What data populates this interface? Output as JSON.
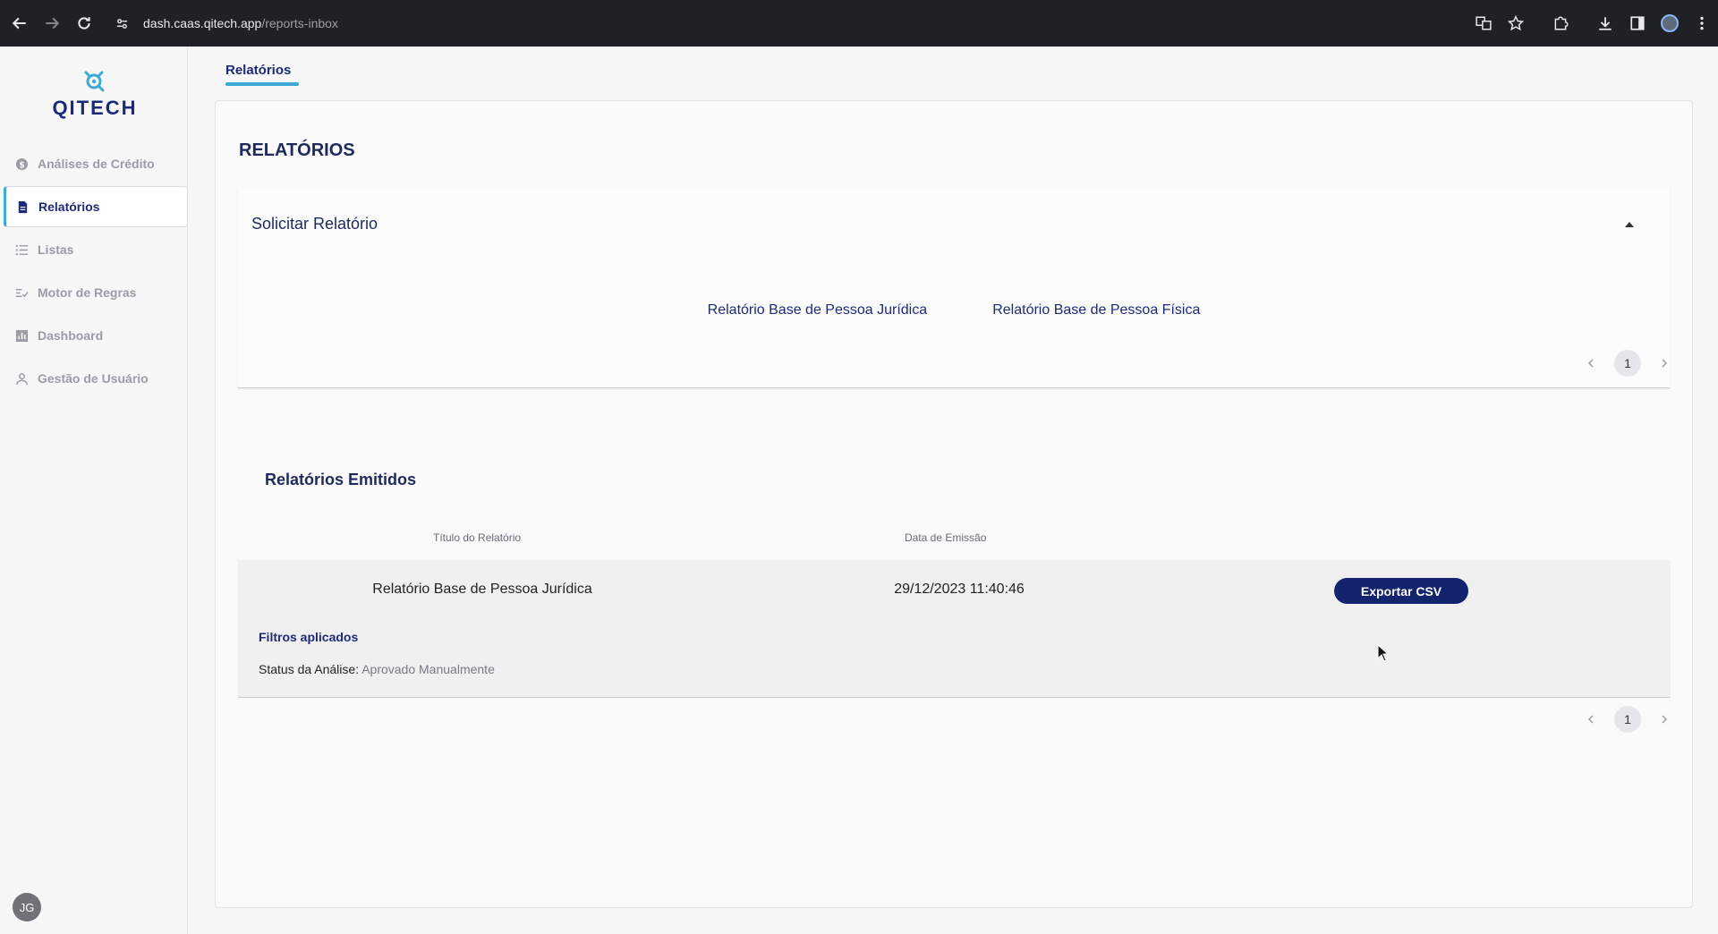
{
  "browser": {
    "url_host": "dash.caas.qitech.app",
    "url_path": "/reports-inbox"
  },
  "sidebar": {
    "logo_text": "QITECH",
    "items": [
      {
        "label": "Análises de Crédito",
        "icon": "dollar-circle-icon",
        "active": false
      },
      {
        "label": "Relatórios",
        "icon": "document-icon",
        "active": true
      },
      {
        "label": "Listas",
        "icon": "list-icon",
        "active": false
      },
      {
        "label": "Motor de Regras",
        "icon": "rules-icon",
        "active": false
      },
      {
        "label": "Dashboard",
        "icon": "bar-chart-icon",
        "active": false
      },
      {
        "label": "Gestão de Usuário",
        "icon": "user-icon",
        "active": false
      }
    ],
    "avatar_initials": "JG"
  },
  "tab": {
    "label": "Relatórios"
  },
  "page": {
    "title": "RELATÓRIOS"
  },
  "request_panel": {
    "title": "Solicitar Relatório",
    "links": [
      "Relatório Base de Pessoa Jurídica",
      "Relatório Base de Pessoa Física"
    ],
    "page": "1"
  },
  "issued": {
    "title": "Relatórios Emitidos",
    "columns": {
      "title": "Título do Relatório",
      "date": "Data de Emissão"
    },
    "rows": [
      {
        "title": "Relatório Base de Pessoa Jurídica",
        "date": "29/12/2023 11:40:46",
        "action": "Exportar CSV",
        "filters_label": "Filtros aplicados",
        "filter_key": "Status da Análise:",
        "filter_value": "Aprovado Manualmente"
      }
    ],
    "page": "1"
  },
  "colors": {
    "brand": "#1d2a7a",
    "accent": "#3ca9d6",
    "button": "#14236e"
  }
}
